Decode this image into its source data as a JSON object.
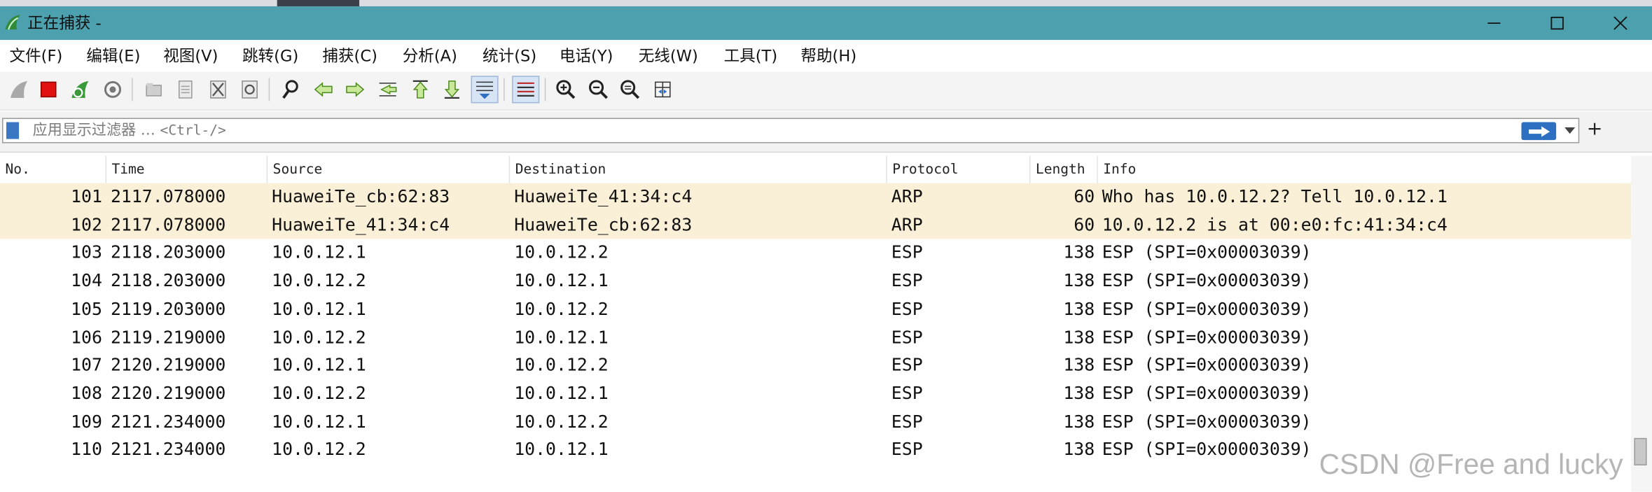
{
  "window": {
    "title": "正在捕获 -",
    "controls": [
      "minimize",
      "maximize",
      "close"
    ]
  },
  "menu": [
    "文件(F)",
    "编辑(E)",
    "视图(V)",
    "跳转(G)",
    "捕获(C)",
    "分析(A)",
    "统计(S)",
    "电话(Y)",
    "无线(W)",
    "工具(T)",
    "帮助(H)"
  ],
  "toolbar": {
    "icons": [
      "shark-fin-start-icon",
      "stop-capture-icon",
      "restart-capture-icon",
      "capture-options-icon",
      "open-file-icon",
      "save-file-icon",
      "close-file-icon",
      "reload-file-icon",
      "find-packet-icon",
      "go-back-icon",
      "go-forward-icon",
      "go-to-packet-icon",
      "first-packet-icon",
      "last-packet-icon",
      "autoscroll-icon",
      "colorize-icon",
      "zoom-in-icon",
      "zoom-out-icon",
      "normal-size-icon",
      "resize-columns-icon"
    ]
  },
  "filter": {
    "placeholder": "应用显示过滤器 …",
    "shortcut": "<Ctrl-/>",
    "add_label": "+"
  },
  "columns": [
    "No.",
    "Time",
    "Source",
    "Destination",
    "Protocol",
    "Length",
    "Info"
  ],
  "packets": [
    {
      "no": "101",
      "time": "2117.078000",
      "source": "HuaweiTe_cb:62:83",
      "destination": "HuaweiTe_41:34:c4",
      "protocol": "ARP",
      "length": "60",
      "info": "Who has 10.0.12.2? Tell 10.0.12.1"
    },
    {
      "no": "102",
      "time": "2117.078000",
      "source": "HuaweiTe_41:34:c4",
      "destination": "HuaweiTe_cb:62:83",
      "protocol": "ARP",
      "length": "60",
      "info": "10.0.12.2 is at 00:e0:fc:41:34:c4"
    },
    {
      "no": "103",
      "time": "2118.203000",
      "source": "10.0.12.1",
      "destination": "10.0.12.2",
      "protocol": "ESP",
      "length": "138",
      "info": "ESP (SPI=0x00003039)"
    },
    {
      "no": "104",
      "time": "2118.203000",
      "source": "10.0.12.2",
      "destination": "10.0.12.1",
      "protocol": "ESP",
      "length": "138",
      "info": "ESP (SPI=0x00003039)"
    },
    {
      "no": "105",
      "time": "2119.203000",
      "source": "10.0.12.1",
      "destination": "10.0.12.2",
      "protocol": "ESP",
      "length": "138",
      "info": "ESP (SPI=0x00003039)"
    },
    {
      "no": "106",
      "time": "2119.219000",
      "source": "10.0.12.2",
      "destination": "10.0.12.1",
      "protocol": "ESP",
      "length": "138",
      "info": "ESP (SPI=0x00003039)"
    },
    {
      "no": "107",
      "time": "2120.219000",
      "source": "10.0.12.1",
      "destination": "10.0.12.2",
      "protocol": "ESP",
      "length": "138",
      "info": "ESP (SPI=0x00003039)"
    },
    {
      "no": "108",
      "time": "2120.219000",
      "source": "10.0.12.2",
      "destination": "10.0.12.1",
      "protocol": "ESP",
      "length": "138",
      "info": "ESP (SPI=0x00003039)"
    },
    {
      "no": "109",
      "time": "2121.234000",
      "source": "10.0.12.1",
      "destination": "10.0.12.2",
      "protocol": "ESP",
      "length": "138",
      "info": "ESP (SPI=0x00003039)"
    },
    {
      "no": "110",
      "time": "2121.234000",
      "source": "10.0.12.2",
      "destination": "10.0.12.1",
      "protocol": "ESP",
      "length": "138",
      "info": "ESP (SPI=0x00003039)"
    }
  ],
  "colors": {
    "titlebar": "#4da0ae",
    "arp_row": "#faf0d7",
    "stop_red": "#e01010",
    "accent_blue": "#2d6fc0"
  },
  "watermark": "CSDN @Free and lucky"
}
